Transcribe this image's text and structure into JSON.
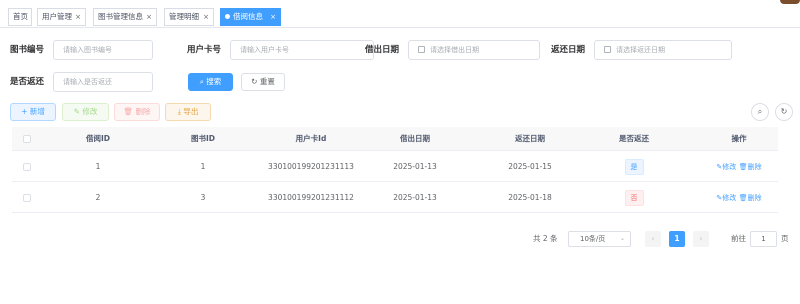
{
  "tags": [
    {
      "label": "首页",
      "closable": false,
      "active": false
    },
    {
      "label": "用户管理",
      "closable": true,
      "active": false
    },
    {
      "label": "图书管理信息",
      "closable": true,
      "active": false
    },
    {
      "label": "管理明细",
      "closable": true,
      "active": false
    },
    {
      "label": "借阅信息",
      "closable": true,
      "active": true
    }
  ],
  "close_glyph": "×",
  "search": {
    "book_id_label": "图书编号",
    "book_id_placeholder": "请输入图书编号",
    "card_label": "用户卡号",
    "card_placeholder": "请输入用户卡号",
    "borrow_date_label": "借出日期",
    "borrow_date_placeholder": "请选择借出日期",
    "return_date_label": "返还日期",
    "return_date_placeholder": "请选择返还日期",
    "returned_label": "是否返还",
    "returned_placeholder": "请输入是否返还",
    "search_button": "搜索",
    "reset_button": "重置"
  },
  "toolbar": {
    "add": "新增",
    "edit": "修改",
    "delete": "删除",
    "export": "导出"
  },
  "table": {
    "columns": [
      "借阅ID",
      "图书ID",
      "用户卡Id",
      "借出日期",
      "返还日期",
      "是否返还",
      "操作"
    ],
    "rows": [
      {
        "borrow_id": "1",
        "book_id": "1",
        "card_id": "330100199201231113",
        "borrow_date": "2025-01-13",
        "return_date": "2025-01-15",
        "returned": "是",
        "edit": "修改",
        "delete": "删除"
      },
      {
        "borrow_id": "2",
        "book_id": "3",
        "card_id": "330100199201231112",
        "borrow_date": "2025-01-13",
        "return_date": "2025-01-18",
        "returned": "否",
        "edit": "修改",
        "delete": "删除"
      }
    ]
  },
  "pagination": {
    "total": "共 2 条",
    "page_size": "10条/页",
    "current_page": "1",
    "goto_prefix": "前往",
    "goto_value": "1",
    "goto_suffix": "页"
  },
  "colors": {
    "primary": "#409eff",
    "success": "#67c23a",
    "danger": "#f56c6c",
    "warning": "#e6a23c"
  }
}
